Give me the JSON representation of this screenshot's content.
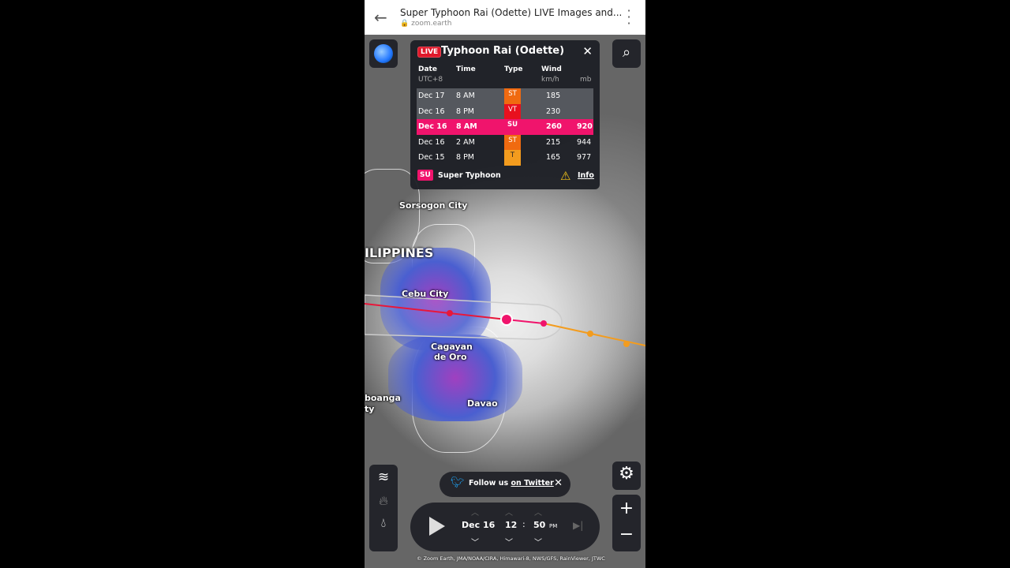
{
  "browser": {
    "title": "Super Typhoon Rai (Odette) LIVE Images and...",
    "url": "zoom.earth"
  },
  "map": {
    "labels": {
      "sorsogon": "Sorsogon City",
      "philippines": "ILIPPINES",
      "cebu": "Cebu City",
      "cagayan1": "Cagayan",
      "cagayan2": "de Oro",
      "davao": "Davao",
      "zamboanga": "boanga",
      "partial": "ty"
    },
    "track_colors": {
      "past": "#e8173a",
      "forecast": "#f39c1e",
      "current": "#f0146c"
    }
  },
  "storm": {
    "live": "LIVE",
    "title": "Typhoon Rai (Odette)",
    "headers": {
      "date": "Date",
      "time": "Time",
      "type": "Type",
      "wind": "Wind",
      "tz": "UTC+8",
      "wind_unit": "km/h",
      "pressure_unit": "mb"
    },
    "rows": [
      {
        "date": "Dec 17",
        "time": "8 AM",
        "type": "ST",
        "wind": "185",
        "pressure": "",
        "color": "#f06a10"
      },
      {
        "date": "Dec 16",
        "time": "8 PM",
        "type": "VT",
        "wind": "230",
        "pressure": "",
        "color": "#e8101e"
      },
      {
        "date": "Dec 16",
        "time": "8 AM",
        "type": "SU",
        "wind": "260",
        "pressure": "920",
        "color": "#f0146c"
      },
      {
        "date": "Dec 16",
        "time": "2 AM",
        "type": "ST",
        "wind": "215",
        "pressure": "944",
        "color": "#f06a10"
      },
      {
        "date": "Dec 15",
        "time": "8 PM",
        "type": "T",
        "wind": "165",
        "pressure": "977",
        "color": "#f39c1e"
      }
    ],
    "legend_code": "SU",
    "legend_label": "Super Typhoon",
    "info": "Info"
  },
  "twitter": {
    "text": "Follow us ",
    "link": "on Twitter"
  },
  "timeline": {
    "date": "Dec 16",
    "hour": "12",
    "sep": ":",
    "minute": "50",
    "ampm": "PM"
  },
  "credit": "© Zoom Earth, JMA/NOAA/CIRA, Himawari-8, NWS/GFS, RainViewer, JTWC"
}
